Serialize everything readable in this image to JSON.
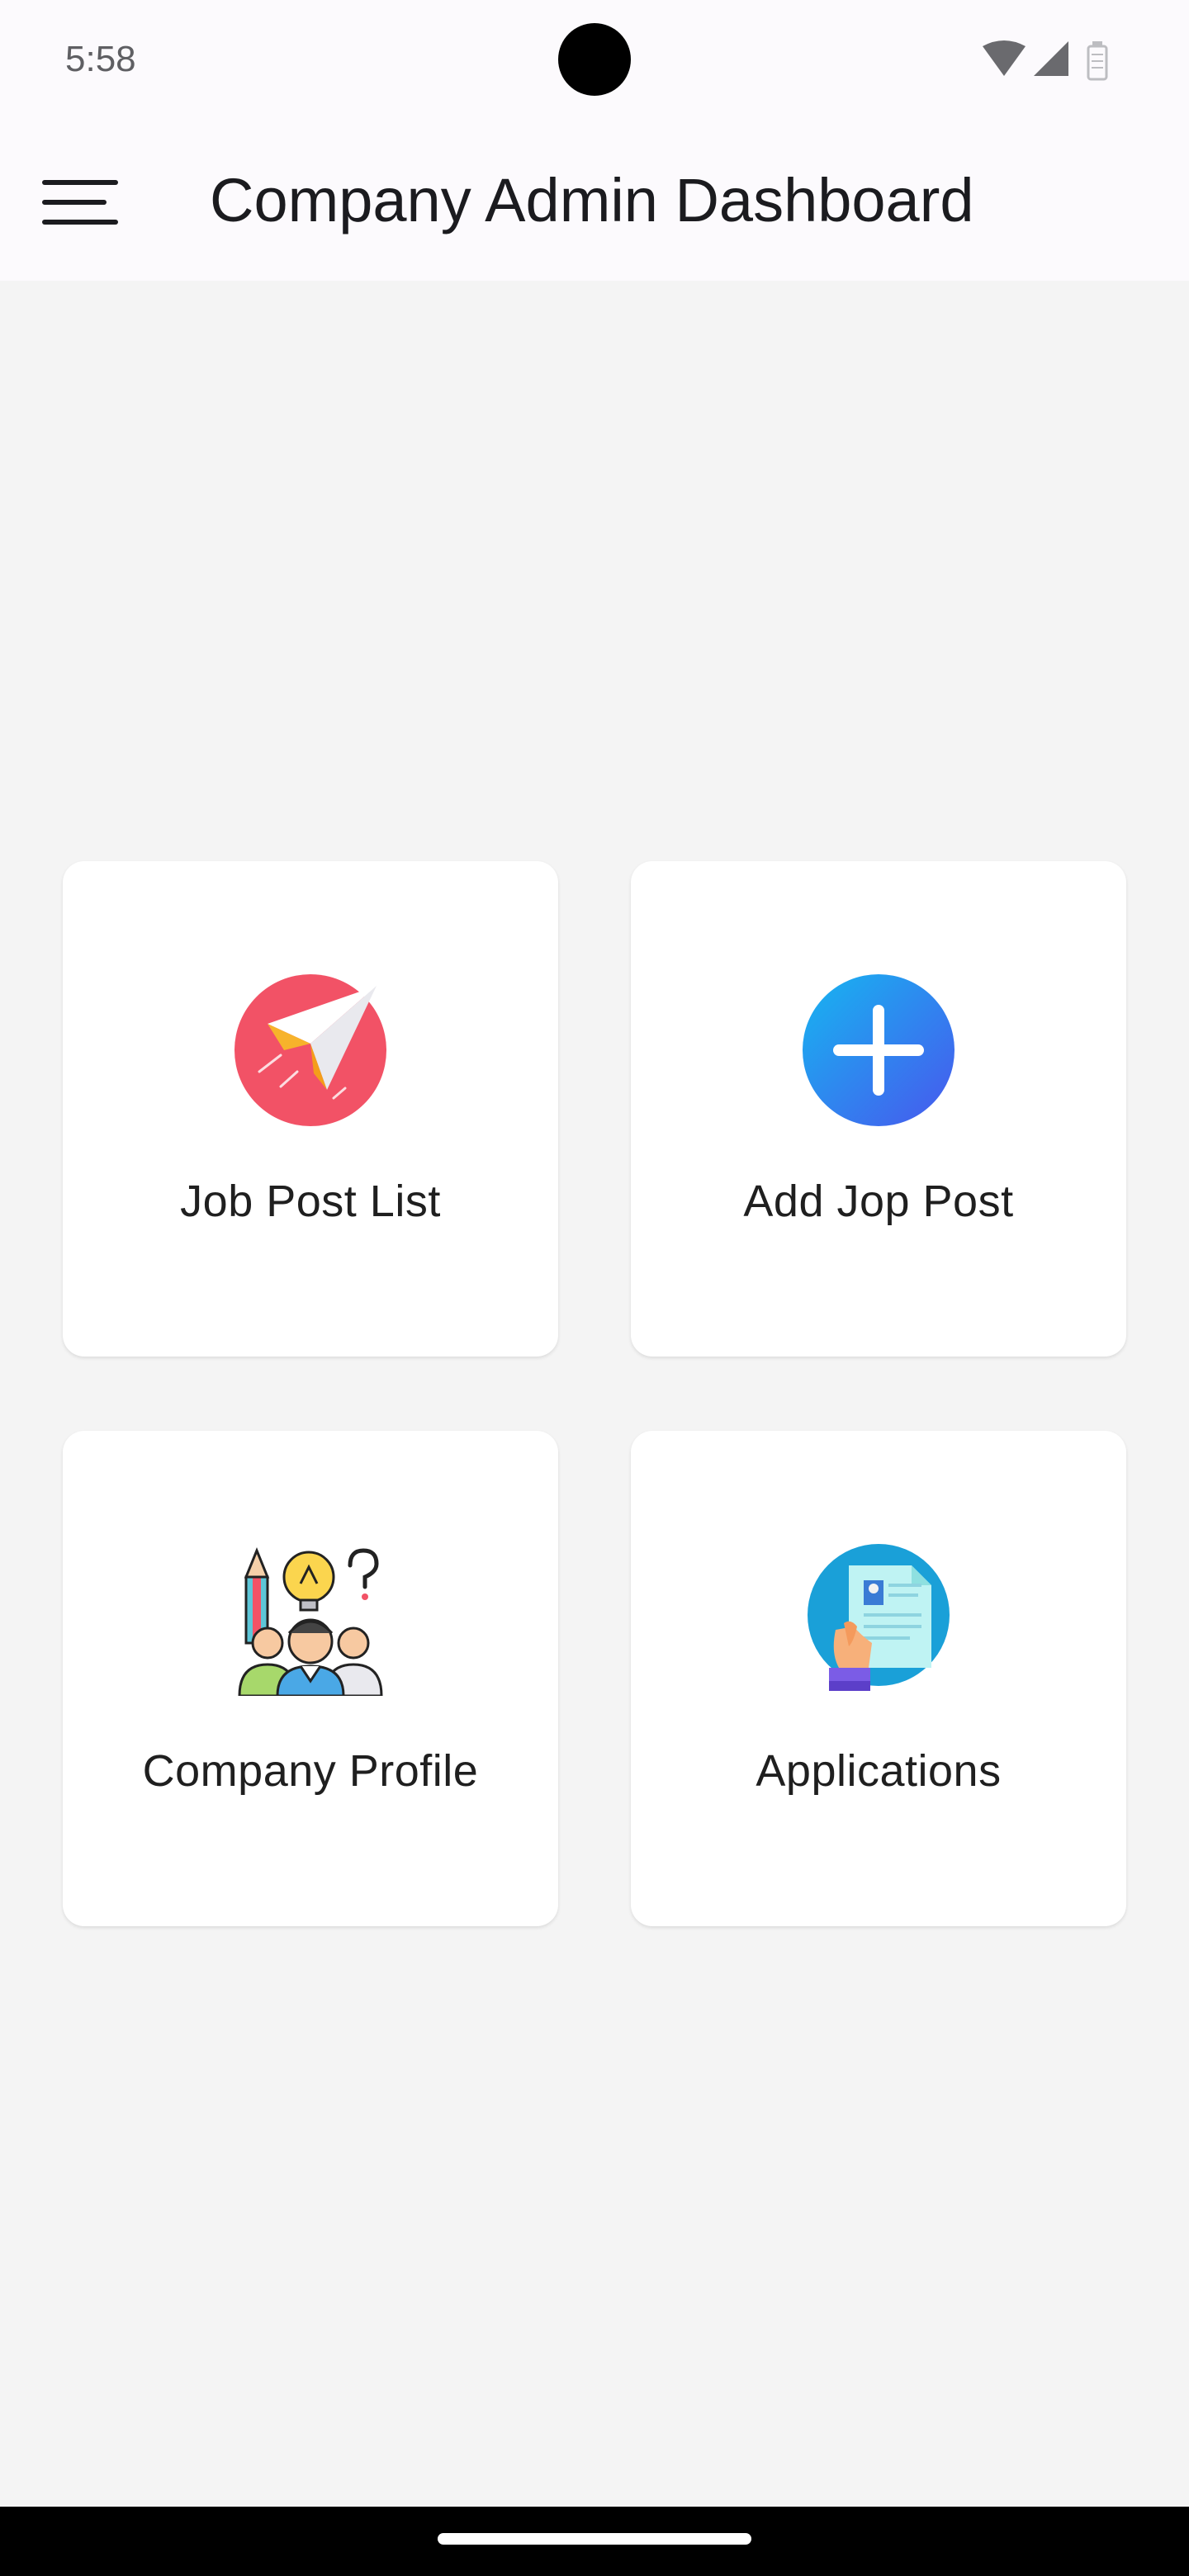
{
  "status_bar": {
    "time": "5:58",
    "icons": [
      "wifi-icon",
      "cellular-signal-icon",
      "battery-icon"
    ]
  },
  "app_bar": {
    "title": "Company Admin Dashboard",
    "menu_icon": "hamburger-menu-icon"
  },
  "dashboard": {
    "cards": [
      {
        "label": "Job Post List",
        "icon": "paper-plane-icon",
        "accent": "#f25266"
      },
      {
        "label": "Add Jop Post",
        "icon": "add-circle-icon",
        "accent": "#2f7af2"
      },
      {
        "label": "Company Profile",
        "icon": "team-ideas-icon",
        "accent": "#f6c94a"
      },
      {
        "label": "Applications",
        "icon": "resume-in-hand-icon",
        "accent": "#1aa0d8"
      }
    ]
  },
  "colors": {
    "background": "#f4f4f4",
    "app_bar": "#fcfafd",
    "card": "#ffffff",
    "text": "#1b1b1f"
  }
}
